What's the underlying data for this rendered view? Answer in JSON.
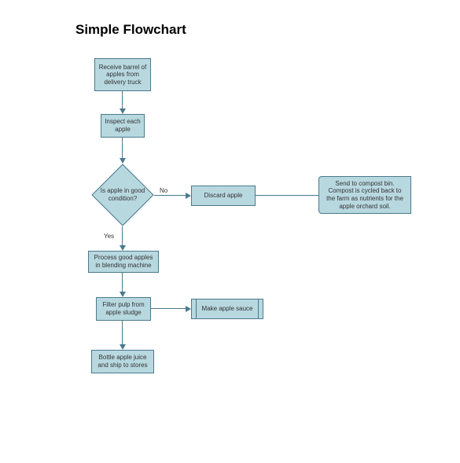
{
  "title": "Simple Flowchart",
  "nodes": {
    "receive": "Receive barrel of apples from delivery truck",
    "inspect": "Inspect each apple",
    "decision": "Is apple in good condition?",
    "discard": "Discard apple",
    "compost": "Send to compost bin. Compost is cycled back to the farm as nutrients for the apple orchard soil.",
    "process": "Process good apples in blending machine",
    "filter": "Filter pulp from apple sludge",
    "sauce": "Make apple sauce",
    "bottle": "Bottle apple juice and ship to stores"
  },
  "labels": {
    "no": "No",
    "yes": "Yes"
  }
}
